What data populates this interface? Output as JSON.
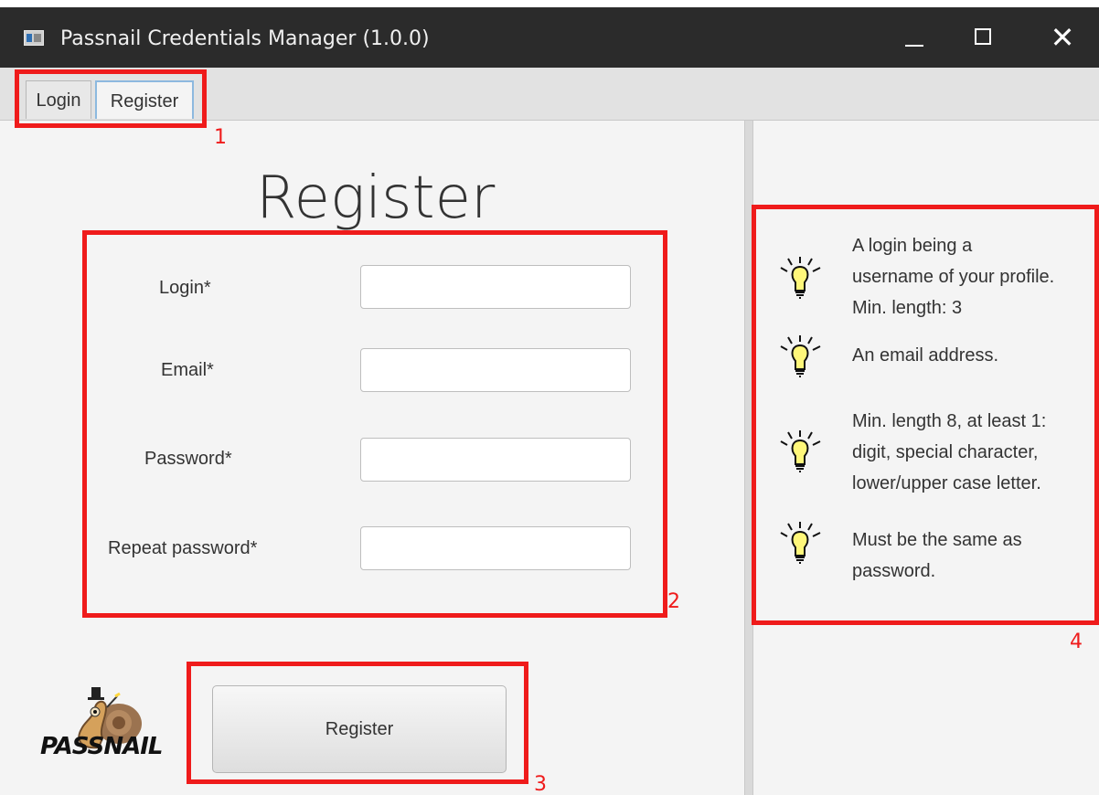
{
  "window": {
    "title": "Passnail Credentials Manager (1.0.0)",
    "controls": {
      "minimize": "—",
      "maximize": "□",
      "close": "✕"
    },
    "app_icon": "app-window-icon"
  },
  "tabs": [
    {
      "label": "Login",
      "selected": false
    },
    {
      "label": "Register",
      "selected": true
    }
  ],
  "form": {
    "heading": "Register",
    "fields": [
      {
        "label": "Login*",
        "value": ""
      },
      {
        "label": "Email*",
        "value": ""
      },
      {
        "label": "Password*",
        "value": ""
      },
      {
        "label": "Repeat password*",
        "value": ""
      }
    ],
    "submit_label": "Register"
  },
  "logo": {
    "text": "PASSNAIL",
    "icon": "snail-mascot-icon"
  },
  "hints": [
    {
      "icon": "lightbulb-icon",
      "text_lines": [
        "A login being a",
        "username of your profile.",
        "Min. length: 3"
      ]
    },
    {
      "icon": "lightbulb-icon",
      "text_lines": [
        "An email address."
      ]
    },
    {
      "icon": "lightbulb-icon",
      "text_lines": [
        "Min. length 8, at least 1:",
        "digit, special character,",
        "lower/upper case letter."
      ]
    },
    {
      "icon": "lightbulb-icon",
      "text_lines": [
        "Must be the same as",
        "password."
      ]
    }
  ],
  "annotations": [
    {
      "number": "1",
      "color": "#ef1b1b"
    },
    {
      "number": "2",
      "color": "#ef1b1b"
    },
    {
      "number": "3",
      "color": "#ef1b1b"
    },
    {
      "number": "4",
      "color": "#ef1b1b"
    }
  ],
  "colors": {
    "titlebar": "#2b2b2b",
    "window_bg": "#f4f4f4",
    "selected_tab_border": "#8db9df",
    "annotation": "#ef1b1b"
  }
}
